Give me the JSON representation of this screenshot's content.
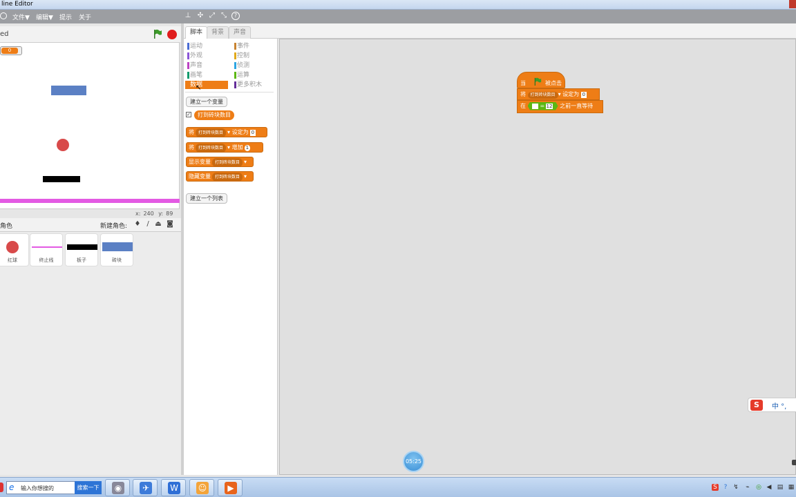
{
  "window": {
    "title": "line Editor"
  },
  "menubar": {
    "file": "文件▼",
    "edit": "编辑▼",
    "tips": "提示",
    "about": "关于"
  },
  "stage": {
    "project_name": "ed",
    "variable_monitor_value": "0",
    "coords": {
      "x_label": "x:",
      "x_value": "240",
      "y_label": "y:",
      "y_value": "89"
    }
  },
  "sprites": {
    "header_label": "角色",
    "new_sprite_label": "新建角色:",
    "items": [
      {
        "label": "红球",
        "color": "#d84a4a"
      },
      {
        "label": "终止线",
        "color": "#e35ae3"
      },
      {
        "label": "板子",
        "color": "#000000"
      },
      {
        "label": "砖块",
        "color": "#5b80c4"
      }
    ]
  },
  "tabs": [
    {
      "label": "脚本",
      "active": true
    },
    {
      "label": "背景",
      "active": false
    },
    {
      "label": "声音",
      "active": false
    }
  ],
  "categories": [
    {
      "label": "运动",
      "color": "#4a6cd4"
    },
    {
      "label": "事件",
      "color": "#c88330"
    },
    {
      "label": "外观",
      "color": "#8a55d7"
    },
    {
      "label": "控制",
      "color": "#e1a91a"
    },
    {
      "label": "声音",
      "color": "#bb42c3"
    },
    {
      "label": "侦测",
      "color": "#2ca5e2"
    },
    {
      "label": "画笔",
      "color": "#0e9a6c"
    },
    {
      "label": "运算",
      "color": "#5cb712"
    },
    {
      "label": "数据",
      "color": "#ee7d16",
      "selected": true
    },
    {
      "label": "更多积木",
      "color": "#632d99"
    }
  ],
  "palette": {
    "make_variable": "建立一个变量",
    "variable_name": "打到砖块数目",
    "blocks": {
      "set_prefix": "将",
      "set_suffix": "设定为",
      "set_value": "0",
      "change_prefix": "将",
      "change_suffix": "增加",
      "change_value": "1",
      "show_var": "显示变量",
      "hide_var": "隐藏变量"
    },
    "make_list": "建立一个列表"
  },
  "script": {
    "hat_when": "当",
    "hat_clicked": "被点击",
    "set_prefix": "将",
    "set_var": "打到砖块数目",
    "set_suffix": "设定为",
    "set_value": "0",
    "wait_prefix": "在",
    "wait_eq": "=",
    "wait_value": "12",
    "wait_suffix": "之前一直等待"
  },
  "timer": "05:25",
  "ime": {
    "logo": "S",
    "text": "中 °,"
  },
  "taskbar": {
    "search_placeholder": "输入你想搜的",
    "search_button": "搜索一下"
  },
  "colors": {
    "data_orange": "#ee7d16",
    "menubar_gray": "#9c9ea2",
    "operator_green": "#5cb712"
  }
}
